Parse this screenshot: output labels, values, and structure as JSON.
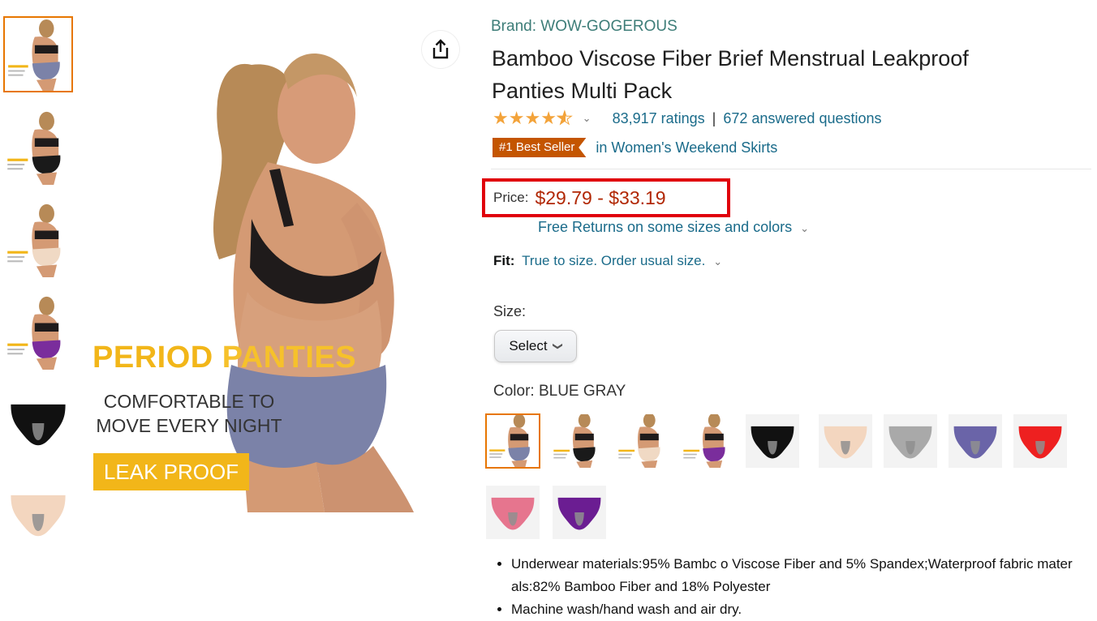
{
  "brand": "Brand: WOW-GOGEROUS",
  "title_line1": "Bamboo Viscose Fiber Brief Menstrual Leakproof",
  "title_line2": "Panties Multi Pack",
  "rating": {
    "stars": 4.5,
    "count_text": "83,917 ratings",
    "separator": "|",
    "answered_text": "672 answered questions"
  },
  "bestseller": {
    "badge": "#1 Best Seller",
    "category": "in Women's Weekend Skirts"
  },
  "price": {
    "label": "Price:",
    "value": "$29.79 - $33.19"
  },
  "free_returns": "Free Returns on some sizes and colors",
  "fit": {
    "label": "Fit:",
    "value": "True to size. Order usual size."
  },
  "size": {
    "label": "Size:",
    "select_value": "Select"
  },
  "color": {
    "label": "Color: BLUE GRAY"
  },
  "main_image": {
    "headline_a": "PERIOD ",
    "headline_b": "PANTIES",
    "sub_line1": "COMFORTABLE TO",
    "sub_line2": "MOVE EVERY NIGHT",
    "badge": "LEAK PROOF"
  },
  "thumbnails": [
    {
      "kind": "model",
      "color": "#7b82a8",
      "label": "PERIOD PANTIES"
    },
    {
      "kind": "model",
      "color": "#1a1a1a",
      "label": "COMFORTABLE"
    },
    {
      "kind": "model",
      "color": "#f0d9c4",
      "label": "BREATHABLE"
    },
    {
      "kind": "model",
      "color": "#7a2d9c",
      "label": "REAR WIDENED"
    },
    {
      "kind": "product",
      "color": "#111111"
    },
    {
      "kind": "product",
      "color": "#f3d6bf"
    }
  ],
  "swatches": [
    {
      "kind": "model",
      "color": "#7b82a8",
      "selected": true
    },
    {
      "kind": "model",
      "color": "#1a1a1a",
      "selected": false
    },
    {
      "kind": "model",
      "color": "#f0d9c4",
      "selected": false
    },
    {
      "kind": "model",
      "color": "#7a2d9c",
      "selected": false
    },
    {
      "kind": "product",
      "color": "#111111",
      "selected": false
    },
    {
      "kind": "product",
      "color": "#f3d6bf",
      "selected": false
    },
    {
      "kind": "product",
      "color": "#a9a9a9",
      "selected": false
    },
    {
      "kind": "product",
      "color": "#6a64a8",
      "selected": false
    },
    {
      "kind": "product",
      "color": "#ee2020",
      "selected": false
    },
    {
      "kind": "product",
      "color": "#e6758e",
      "selected": false
    },
    {
      "kind": "product",
      "color": "#6b1d92",
      "selected": false
    }
  ],
  "bullets": [
    "Underwear materials:95% Bambc o Viscose Fiber and 5% Spandex;Waterproof fabric mater als:82% Bamboo Fiber and 18% Polyester",
    "Machine wash/hand wash and air dry."
  ],
  "colors": {
    "price": "#b12704",
    "link": "#1a6b8a",
    "brand": "#3d7d78",
    "highlight_box": "#e0000a",
    "badge": "#c45500",
    "accent_yellow": "#f2b619",
    "selected_border": "#e77600"
  }
}
